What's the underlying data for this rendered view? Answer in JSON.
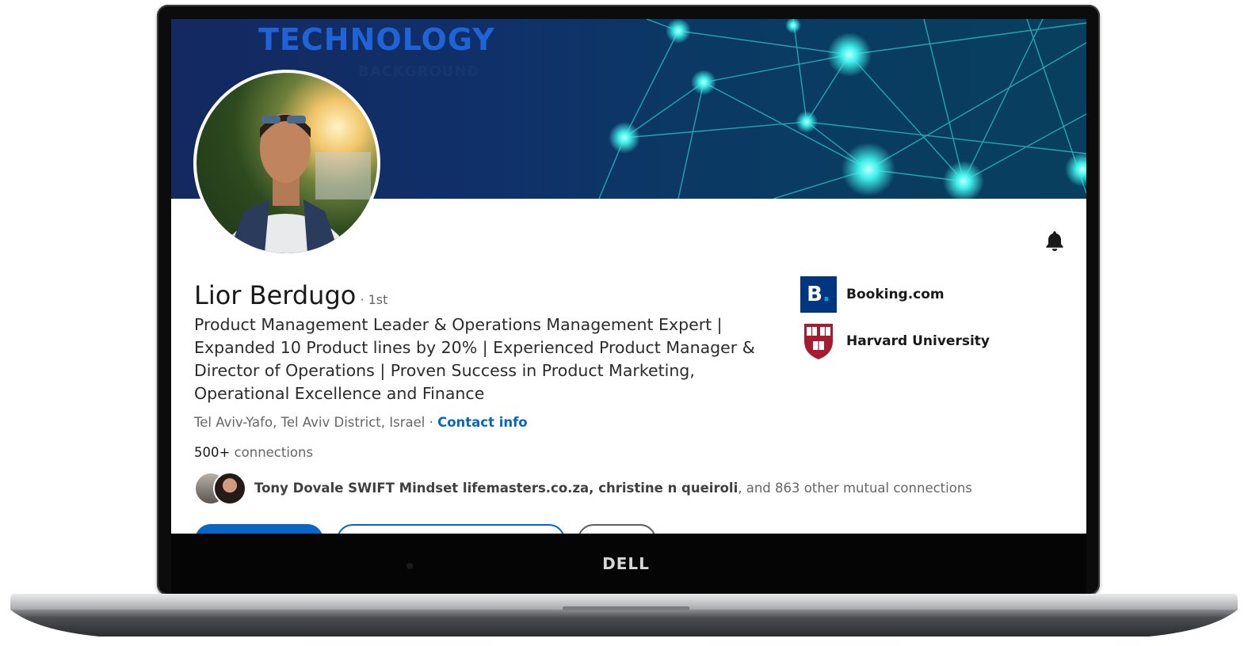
{
  "device": {
    "brand": "DELL"
  },
  "banner": {
    "title": "TECHNOLOGY",
    "subtitle": "BACKGROUND"
  },
  "profile": {
    "name": "Lior Berdugo",
    "degree": "· 1st",
    "headline": "Product Management Leader & Operations Management Expert | Expanded 10 Product lines by 20% | Experienced Product Manager & Director of Operations | Proven Success in Product Marketing, Operational Excellence and Finance",
    "location": "Tel Aviv-Yafo, Tel Aviv District, Israel",
    "location_separator": " · ",
    "contact_info": "Contact info",
    "connections_count": "500+",
    "connections_label": " connections",
    "mutual_names": "Tony Dovale SWIFT Mindset lifemasters.co.za, christine n queiroli",
    "mutual_rest": ", and 863 other mutual connections"
  },
  "experience": {
    "company": "Booking.com",
    "company_logo_text": "B",
    "school": "Harvard University"
  },
  "icons": {
    "notification": "bell-icon"
  },
  "colors": {
    "link_blue": "#0a66c2",
    "booking_blue": "#003580",
    "harvard_crimson": "#a51c30"
  }
}
